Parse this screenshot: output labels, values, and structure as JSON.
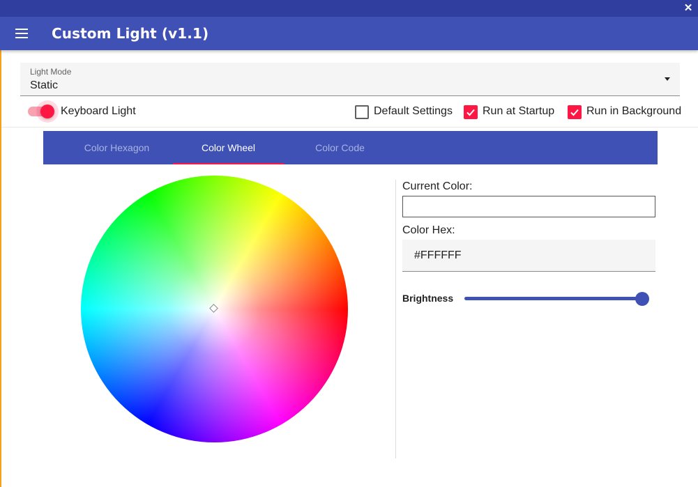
{
  "window": {
    "close_glyph": "✕"
  },
  "appbar": {
    "title": "Custom Light (v1.1)",
    "menu_icon": "hamburger-menu-icon"
  },
  "light_mode": {
    "label": "Light Mode",
    "value": "Static"
  },
  "keyboard_light": {
    "label": "Keyboard Light",
    "on": true
  },
  "options": [
    {
      "label": "Default Settings",
      "checked": false
    },
    {
      "label": "Run at Startup",
      "checked": true
    },
    {
      "label": "Run in Background",
      "checked": true
    }
  ],
  "tabs": [
    {
      "label": "Color Hexagon",
      "active": false
    },
    {
      "label": "Color Wheel",
      "active": true
    },
    {
      "label": "Color Code",
      "active": false
    }
  ],
  "panel": {
    "current_color_label": "Current Color:",
    "current_color": "#FFFFFF",
    "color_hex_label": "Color Hex:",
    "color_hex_value": "#FFFFFF",
    "brightness_label": "Brightness",
    "brightness": 1.0
  },
  "colors": {
    "primary": "#3f51b5",
    "primary_dark": "#303f9f",
    "accent": "#ff1744"
  }
}
